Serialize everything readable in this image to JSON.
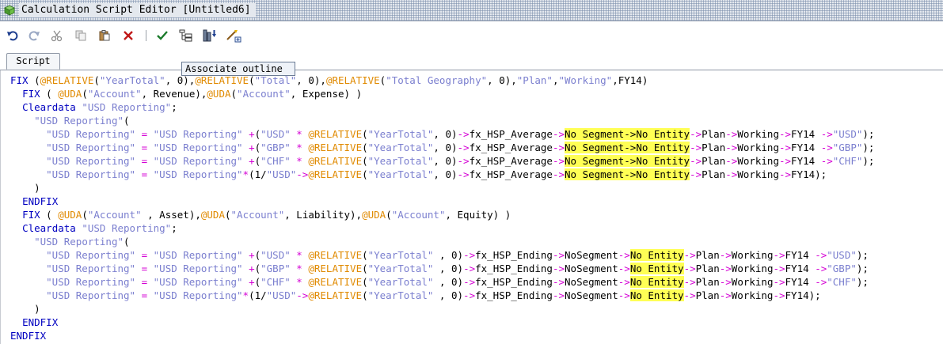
{
  "window": {
    "title": "Calculation Script Editor [Untitled6]",
    "icon": "cube-icon"
  },
  "toolbar": {
    "buttons": [
      {
        "name": "undo",
        "icon": "undo-icon"
      },
      {
        "name": "redo",
        "icon": "redo-icon"
      },
      {
        "name": "cut",
        "icon": "scissors-icon"
      },
      {
        "name": "copy",
        "icon": "copy-icon"
      },
      {
        "name": "paste",
        "icon": "paste-icon"
      },
      {
        "name": "delete",
        "icon": "delete-x-icon"
      },
      {
        "name": "validate",
        "icon": "checkmark-icon"
      },
      {
        "name": "associate-outline",
        "icon": "outline-icon"
      },
      {
        "name": "execute",
        "icon": "execute-icon"
      },
      {
        "name": "insert-function",
        "icon": "wand-icon"
      }
    ],
    "tooltip": "Associate outline"
  },
  "tabs": [
    {
      "label": "Script",
      "active": true
    }
  ],
  "colors": {
    "keyword": "#0000c0",
    "function": "#e08a00",
    "string": "#7b7fcf",
    "operator": "#d400d4",
    "highlight": "#ffff55"
  },
  "editor": {
    "lines": [
      [
        [
          "kw",
          "FIX "
        ],
        [
          "plain",
          "("
        ],
        [
          "fn",
          "@RELATIVE"
        ],
        [
          "plain",
          "("
        ],
        [
          "str",
          "\"YearTotal\""
        ],
        [
          "plain",
          ", 0),"
        ],
        [
          "fn",
          "@RELATIVE"
        ],
        [
          "plain",
          "("
        ],
        [
          "str",
          "\"Total\""
        ],
        [
          "plain",
          ", 0),"
        ],
        [
          "fn",
          "@RELATIVE"
        ],
        [
          "plain",
          "("
        ],
        [
          "str",
          "\"Total Geography\""
        ],
        [
          "plain",
          ", 0),"
        ],
        [
          "str",
          "\"Plan\""
        ],
        [
          "plain",
          ","
        ],
        [
          "str",
          "\"Working\""
        ],
        [
          "plain",
          ",FY14)"
        ]
      ],
      [
        [
          "plain",
          "  "
        ],
        [
          "kw",
          "FIX "
        ],
        [
          "plain",
          "( "
        ],
        [
          "fn",
          "@UDA"
        ],
        [
          "plain",
          "("
        ],
        [
          "str",
          "\"Account\""
        ],
        [
          "plain",
          ", Revenue),"
        ],
        [
          "fn",
          "@UDA"
        ],
        [
          "plain",
          "("
        ],
        [
          "str",
          "\"Account\""
        ],
        [
          "plain",
          ", Expense) )"
        ]
      ],
      [
        [
          "plain",
          "  "
        ],
        [
          "kw",
          "Cleardata "
        ],
        [
          "str",
          "\"USD Reporting\""
        ],
        [
          "plain",
          ";"
        ]
      ],
      [
        [
          "plain",
          "    "
        ],
        [
          "str",
          "\"USD Reporting\""
        ],
        [
          "plain",
          "("
        ]
      ],
      [
        [
          "plain",
          "      "
        ],
        [
          "str",
          "\"USD Reporting\""
        ],
        [
          "plain",
          " "
        ],
        [
          "op",
          "="
        ],
        [
          "plain",
          " "
        ],
        [
          "str",
          "\"USD Reporting\""
        ],
        [
          "plain",
          " "
        ],
        [
          "op",
          "+"
        ],
        [
          "plain",
          "("
        ],
        [
          "str",
          "\"USD\""
        ],
        [
          "plain",
          " "
        ],
        [
          "op",
          "*"
        ],
        [
          "plain",
          " "
        ],
        [
          "fn",
          "@RELATIVE"
        ],
        [
          "plain",
          "("
        ],
        [
          "str",
          "\"YearTotal\""
        ],
        [
          "plain",
          ", 0)"
        ],
        [
          "op",
          "->"
        ],
        [
          "plain",
          "fx_HSP_Average"
        ],
        [
          "op",
          "->"
        ],
        [
          "hl",
          "No Segment->No Entity"
        ],
        [
          "op",
          "->"
        ],
        [
          "plain",
          "Plan"
        ],
        [
          "op",
          "->"
        ],
        [
          "plain",
          "Working"
        ],
        [
          "op",
          "->"
        ],
        [
          "plain",
          "FY14 "
        ],
        [
          "op",
          "->"
        ],
        [
          "str",
          "\"USD\""
        ],
        [
          "plain",
          ");"
        ]
      ],
      [
        [
          "plain",
          "      "
        ],
        [
          "str",
          "\"USD Reporting\""
        ],
        [
          "plain",
          " "
        ],
        [
          "op",
          "="
        ],
        [
          "plain",
          " "
        ],
        [
          "str",
          "\"USD Reporting\""
        ],
        [
          "plain",
          " "
        ],
        [
          "op",
          "+"
        ],
        [
          "plain",
          "("
        ],
        [
          "str",
          "\"GBP\""
        ],
        [
          "plain",
          " "
        ],
        [
          "op",
          "*"
        ],
        [
          "plain",
          " "
        ],
        [
          "fn",
          "@RELATIVE"
        ],
        [
          "plain",
          "("
        ],
        [
          "str",
          "\"YearTotal\""
        ],
        [
          "plain",
          ", 0)"
        ],
        [
          "op",
          "->"
        ],
        [
          "plain",
          "fx_HSP_Average"
        ],
        [
          "op",
          "->"
        ],
        [
          "hl",
          "No Segment->No Entity"
        ],
        [
          "op",
          "->"
        ],
        [
          "plain",
          "Plan"
        ],
        [
          "op",
          "->"
        ],
        [
          "plain",
          "Working"
        ],
        [
          "op",
          "->"
        ],
        [
          "plain",
          "FY14 "
        ],
        [
          "op",
          "->"
        ],
        [
          "str",
          "\"GBP\""
        ],
        [
          "plain",
          ");"
        ]
      ],
      [
        [
          "plain",
          "      "
        ],
        [
          "str",
          "\"USD Reporting\""
        ],
        [
          "plain",
          " "
        ],
        [
          "op",
          "="
        ],
        [
          "plain",
          " "
        ],
        [
          "str",
          "\"USD Reporting\""
        ],
        [
          "plain",
          " "
        ],
        [
          "op",
          "+"
        ],
        [
          "plain",
          "("
        ],
        [
          "str",
          "\"CHF\""
        ],
        [
          "plain",
          " "
        ],
        [
          "op",
          "*"
        ],
        [
          "plain",
          " "
        ],
        [
          "fn",
          "@RELATIVE"
        ],
        [
          "plain",
          "("
        ],
        [
          "str",
          "\"YearTotal\""
        ],
        [
          "plain",
          ", 0)"
        ],
        [
          "op",
          "->"
        ],
        [
          "plain",
          "fx_HSP_Average"
        ],
        [
          "op",
          "->"
        ],
        [
          "hl",
          "No Segment->No Entity"
        ],
        [
          "op",
          "->"
        ],
        [
          "plain",
          "Plan"
        ],
        [
          "op",
          "->"
        ],
        [
          "plain",
          "Working"
        ],
        [
          "op",
          "->"
        ],
        [
          "plain",
          "FY14 "
        ],
        [
          "op",
          "->"
        ],
        [
          "str",
          "\"CHF\""
        ],
        [
          "plain",
          ");"
        ]
      ],
      [
        [
          "plain",
          "      "
        ],
        [
          "str",
          "\"USD Reporting\""
        ],
        [
          "plain",
          " "
        ],
        [
          "op",
          "="
        ],
        [
          "plain",
          " "
        ],
        [
          "str",
          "\"USD Reporting\""
        ],
        [
          "op",
          "*"
        ],
        [
          "plain",
          "(1/"
        ],
        [
          "str",
          "\"USD\""
        ],
        [
          "op",
          "->"
        ],
        [
          "fn",
          "@RELATIVE"
        ],
        [
          "plain",
          "("
        ],
        [
          "str",
          "\"YearTotal\""
        ],
        [
          "plain",
          ", 0)"
        ],
        [
          "op",
          "->"
        ],
        [
          "plain",
          "fx_HSP_Average"
        ],
        [
          "op",
          "->"
        ],
        [
          "hl",
          "No Segment->No Entity"
        ],
        [
          "op",
          "->"
        ],
        [
          "plain",
          "Plan"
        ],
        [
          "op",
          "->"
        ],
        [
          "plain",
          "Working"
        ],
        [
          "op",
          "->"
        ],
        [
          "plain",
          "FY14);"
        ]
      ],
      [
        [
          "plain",
          "    )"
        ]
      ],
      [
        [
          "plain",
          "  "
        ],
        [
          "kw",
          "ENDFIX"
        ]
      ],
      [
        [
          "plain",
          "  "
        ],
        [
          "kw",
          "FIX "
        ],
        [
          "plain",
          "( "
        ],
        [
          "fn",
          "@UDA"
        ],
        [
          "plain",
          "("
        ],
        [
          "str",
          "\"Account\""
        ],
        [
          "plain",
          " , Asset),"
        ],
        [
          "fn",
          "@UDA"
        ],
        [
          "plain",
          "("
        ],
        [
          "str",
          "\"Account\""
        ],
        [
          "plain",
          ", Liability),"
        ],
        [
          "fn",
          "@UDA"
        ],
        [
          "plain",
          "("
        ],
        [
          "str",
          "\"Account\""
        ],
        [
          "plain",
          ", Equity) )"
        ]
      ],
      [
        [
          "plain",
          "  "
        ],
        [
          "kw",
          "Cleardata "
        ],
        [
          "str",
          "\"USD Reporting\""
        ],
        [
          "plain",
          ";"
        ]
      ],
      [
        [
          "plain",
          "    "
        ],
        [
          "str",
          "\"USD Reporting\""
        ],
        [
          "plain",
          "("
        ]
      ],
      [
        [
          "plain",
          "      "
        ],
        [
          "str",
          "\"USD Reporting\""
        ],
        [
          "plain",
          " "
        ],
        [
          "op",
          "="
        ],
        [
          "plain",
          " "
        ],
        [
          "str",
          "\"USD Reporting\""
        ],
        [
          "plain",
          " "
        ],
        [
          "op",
          "+"
        ],
        [
          "plain",
          "("
        ],
        [
          "str",
          "\"USD\""
        ],
        [
          "plain",
          " "
        ],
        [
          "op",
          "*"
        ],
        [
          "plain",
          " "
        ],
        [
          "fn",
          "@RELATIVE"
        ],
        [
          "plain",
          "("
        ],
        [
          "str",
          "\"YearTotal\""
        ],
        [
          "plain",
          " , 0)"
        ],
        [
          "op",
          "->"
        ],
        [
          "plain",
          "fx_HSP_Ending"
        ],
        [
          "op",
          "->"
        ],
        [
          "plain",
          "NoSegment"
        ],
        [
          "op",
          "->"
        ],
        [
          "hl",
          "No Entity"
        ],
        [
          "op",
          "->"
        ],
        [
          "plain",
          "Plan"
        ],
        [
          "op",
          "->"
        ],
        [
          "plain",
          "Working"
        ],
        [
          "op",
          "->"
        ],
        [
          "plain",
          "FY14 "
        ],
        [
          "op",
          "->"
        ],
        [
          "str",
          "\"USD\""
        ],
        [
          "plain",
          ");"
        ]
      ],
      [
        [
          "plain",
          "      "
        ],
        [
          "str",
          "\"USD Reporting\""
        ],
        [
          "plain",
          " "
        ],
        [
          "op",
          "="
        ],
        [
          "plain",
          " "
        ],
        [
          "str",
          "\"USD Reporting\""
        ],
        [
          "plain",
          " "
        ],
        [
          "op",
          "+"
        ],
        [
          "plain",
          "("
        ],
        [
          "str",
          "\"GBP\""
        ],
        [
          "plain",
          " "
        ],
        [
          "op",
          "*"
        ],
        [
          "plain",
          " "
        ],
        [
          "fn",
          "@RELATIVE"
        ],
        [
          "plain",
          "("
        ],
        [
          "str",
          "\"YearTotal\""
        ],
        [
          "plain",
          " , 0)"
        ],
        [
          "op",
          "->"
        ],
        [
          "plain",
          "fx_HSP_Ending"
        ],
        [
          "op",
          "->"
        ],
        [
          "plain",
          "NoSegment"
        ],
        [
          "op",
          "->"
        ],
        [
          "hl",
          "No Entity"
        ],
        [
          "op",
          "->"
        ],
        [
          "plain",
          "Plan"
        ],
        [
          "op",
          "->"
        ],
        [
          "plain",
          "Working"
        ],
        [
          "op",
          "->"
        ],
        [
          "plain",
          "FY14 "
        ],
        [
          "op",
          "->"
        ],
        [
          "str",
          "\"GBP\""
        ],
        [
          "plain",
          ");"
        ]
      ],
      [
        [
          "plain",
          "      "
        ],
        [
          "str",
          "\"USD Reporting\""
        ],
        [
          "plain",
          " "
        ],
        [
          "op",
          "="
        ],
        [
          "plain",
          " "
        ],
        [
          "str",
          "\"USD Reporting\""
        ],
        [
          "plain",
          " "
        ],
        [
          "op",
          "+"
        ],
        [
          "plain",
          "("
        ],
        [
          "str",
          "\"CHF\""
        ],
        [
          "plain",
          " "
        ],
        [
          "op",
          "*"
        ],
        [
          "plain",
          " "
        ],
        [
          "fn",
          "@RELATIVE"
        ],
        [
          "plain",
          "("
        ],
        [
          "str",
          "\"YearTotal\""
        ],
        [
          "plain",
          " , 0)"
        ],
        [
          "op",
          "->"
        ],
        [
          "plain",
          "fx_HSP_Ending"
        ],
        [
          "op",
          "->"
        ],
        [
          "plain",
          "NoSegment"
        ],
        [
          "op",
          "->"
        ],
        [
          "hl",
          "No Entity"
        ],
        [
          "op",
          "->"
        ],
        [
          "plain",
          "Plan"
        ],
        [
          "op",
          "->"
        ],
        [
          "plain",
          "Working"
        ],
        [
          "op",
          "->"
        ],
        [
          "plain",
          "FY14 "
        ],
        [
          "op",
          "->"
        ],
        [
          "str",
          "\"CHF\""
        ],
        [
          "plain",
          ");"
        ]
      ],
      [
        [
          "plain",
          "      "
        ],
        [
          "str",
          "\"USD Reporting\""
        ],
        [
          "plain",
          " "
        ],
        [
          "op",
          "="
        ],
        [
          "plain",
          " "
        ],
        [
          "str",
          "\"USD Reporting\""
        ],
        [
          "op",
          "*"
        ],
        [
          "plain",
          "(1/"
        ],
        [
          "str",
          "\"USD\""
        ],
        [
          "op",
          "->"
        ],
        [
          "fn",
          "@RELATIVE"
        ],
        [
          "plain",
          "("
        ],
        [
          "str",
          "\"YearTotal\""
        ],
        [
          "plain",
          " , 0)"
        ],
        [
          "op",
          "->"
        ],
        [
          "plain",
          "fx_HSP_Ending"
        ],
        [
          "op",
          "->"
        ],
        [
          "plain",
          "NoSegment"
        ],
        [
          "op",
          "->"
        ],
        [
          "hl",
          "No Entity"
        ],
        [
          "op",
          "->"
        ],
        [
          "plain",
          "Plan"
        ],
        [
          "op",
          "->"
        ],
        [
          "plain",
          "Working"
        ],
        [
          "op",
          "->"
        ],
        [
          "plain",
          "FY14);"
        ]
      ],
      [
        [
          "plain",
          "    )"
        ]
      ],
      [
        [
          "plain",
          "  "
        ],
        [
          "kw",
          "ENDFIX"
        ]
      ],
      [
        [
          "kw",
          "ENDFIX"
        ]
      ]
    ]
  }
}
